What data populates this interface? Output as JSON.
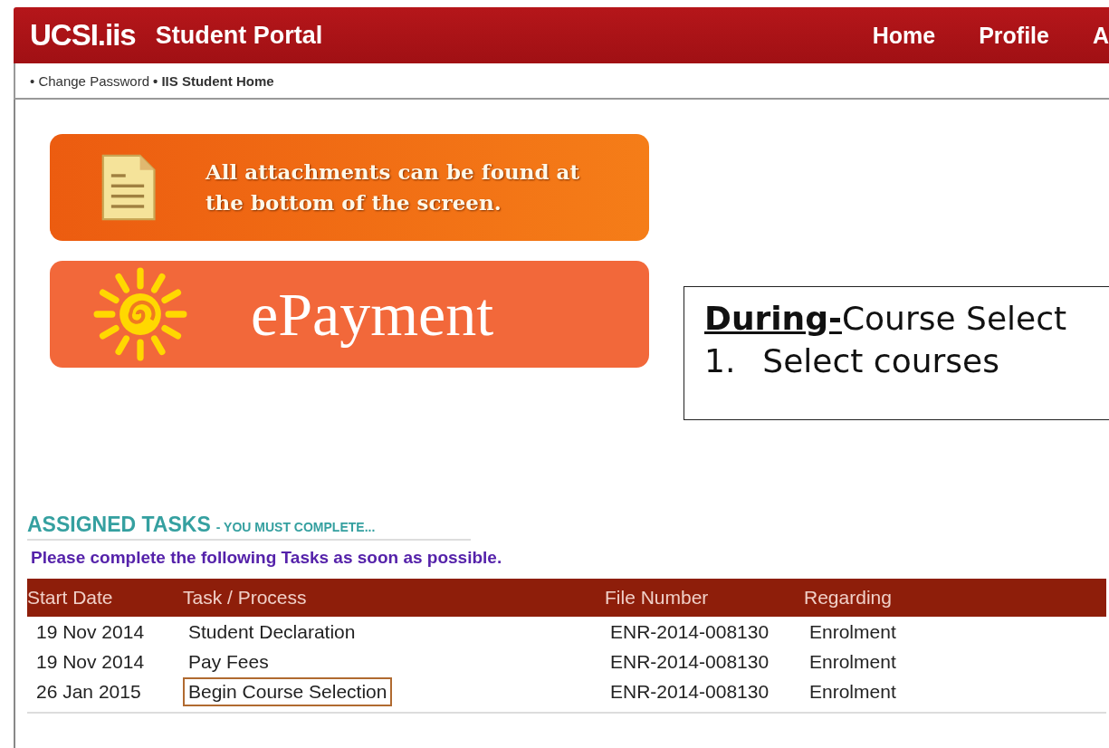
{
  "header": {
    "logo": "UCSI.iis",
    "title": "Student Portal",
    "nav": [
      {
        "label": "Home"
      },
      {
        "label": "Profile"
      },
      {
        "label": "A"
      }
    ]
  },
  "breadcrumb": [
    {
      "label": "• Change Password"
    },
    {
      "label": "• IIS Student Home"
    }
  ],
  "banners": [
    {
      "kind": "attachments",
      "text": "All attachments can be found at the bottom of the screen."
    },
    {
      "kind": "payment",
      "text": "ePayment"
    }
  ],
  "callout": {
    "heading": "**During-**Course Select",
    "items": [
      {
        "number": "1.",
        "text": "Select courses"
      }
    ]
  },
  "tasks": {
    "heading": "ASSIGNED TASKS",
    "subheading": "- YOU MUST COMPLETE...",
    "note": "Please complete the following Tasks as soon as possible.",
    "columns": [
      "Start Date",
      "Task / Process",
      "File Number",
      "Regarding"
    ],
    "rows": [
      {
        "cells": [
          "19 Nov 2014",
          "Student Declaration",
          "ENR-2014-008130",
          "Enrolment"
        ],
        "highlighted": false
      },
      {
        "cells": [
          "19 Nov 2014",
          "Pay Fees",
          "ENR-2014-008130",
          "Enrolment"
        ],
        "highlighted": false
      },
      {
        "cells": [
          "26 Jan 2015",
          "Begin Course Selection",
          "ENR-2014-008130",
          "Enrolment"
        ],
        "highlighted": true
      }
    ]
  }
}
